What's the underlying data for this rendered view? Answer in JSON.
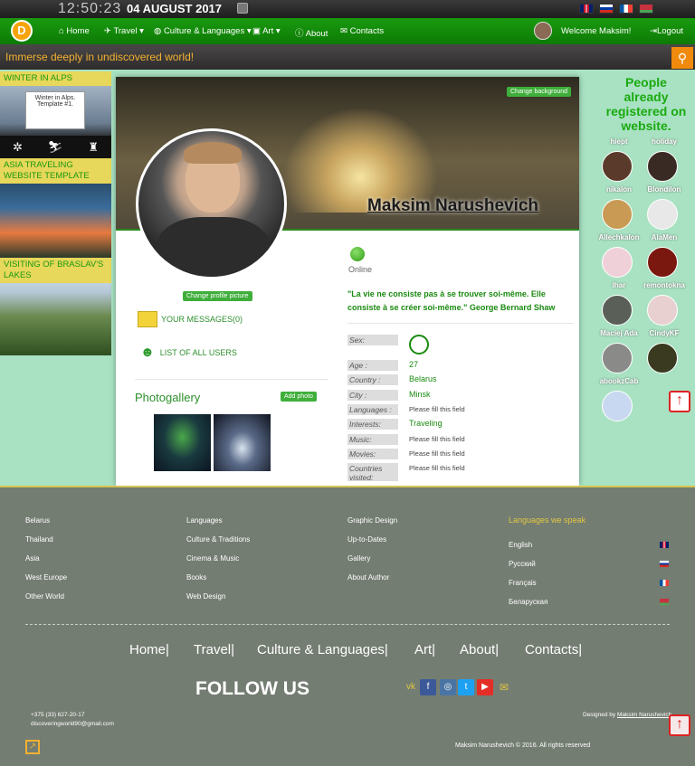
{
  "topbar": {
    "time": "12:50:23",
    "date": "04 AUGUST 2017"
  },
  "nav": {
    "logo": "D",
    "items": [
      "Home",
      "Travel ▾",
      "Culture & Languages ▾",
      "Art ▾",
      "About",
      "Contacts"
    ],
    "welcome": "Welcome Maksim!",
    "logout": "Logout"
  },
  "ticker": {
    "text": "Immerse deeply in undiscovered world!"
  },
  "sidebar": {
    "cards": [
      {
        "title": "WINTER IN ALPS",
        "caption": "Winter in Alps. Template #1."
      },
      {
        "title": "ASIA TRAVELING WEBSITE TEMPLATE"
      },
      {
        "title": "VISITING OF BRASLAV'S LAKES"
      }
    ]
  },
  "profile": {
    "name": "Maksim Narushevich",
    "change_bg": "Change background",
    "change_pic": "Change profile picture",
    "messages": "YOUR MESSAGES(0)",
    "users": "LIST OF ALL USERS",
    "gallery_title": "Photogallery",
    "add_photo": "Add photo",
    "status": "Online",
    "quote": "\"La vie ne consiste pas à se trouver soi-même. Elle consiste à se créer soi-même.\" George Bernard Shaw",
    "fields": [
      {
        "label": "Sex:",
        "value": ""
      },
      {
        "label": "Age :",
        "value": "27"
      },
      {
        "label": "Country :",
        "value": "Belarus"
      },
      {
        "label": "City :",
        "value": "Minsk"
      },
      {
        "label": "Languages :",
        "value": "Please fill this field"
      },
      {
        "label": "Interests:",
        "value": "Traveling"
      },
      {
        "label": "Music:",
        "value": "Please fill this field"
      },
      {
        "label": "Movies:",
        "value": "Please fill this field"
      },
      {
        "label": "Countries visited:",
        "value": "Please fill this field"
      }
    ]
  },
  "people": {
    "title": "People already registered on website.",
    "users": [
      {
        "name": "hiept",
        "color": "#5a3a2a"
      },
      {
        "name": "holiday",
        "color": "#3a2a24"
      },
      {
        "name": "nikalon",
        "color": "#c89a54"
      },
      {
        "name": "Blondilon",
        "color": "#e8e8e8"
      },
      {
        "name": "Allechkalon",
        "color": "#f0d0d8"
      },
      {
        "name": "AlaMen",
        "color": "#7a1810"
      },
      {
        "name": "Ihar",
        "color": "#5a6058"
      },
      {
        "name": "remontokna",
        "color": "#e8d0d0"
      },
      {
        "name": "Maciej Ada",
        "color": "#8a8a88"
      },
      {
        "name": "CindyKF",
        "color": "#3a3a20"
      },
      {
        "name": "abookzCab",
        "color": "#c8d8f0"
      }
    ]
  },
  "footer": {
    "col1": [
      "Belarus",
      "Thailand",
      "Asia",
      "West Europe",
      "Other World"
    ],
    "col2": [
      "Languages",
      "Culture & Traditions",
      "Cinema & Music",
      "Books",
      "Web Design"
    ],
    "col3": [
      "Graphic Design",
      "Up-to-Dates",
      "Gallery",
      "About Author"
    ],
    "lang_title": "Languages we speak",
    "langs": [
      "English",
      "Русский",
      "Français",
      "Беларуская"
    ],
    "nav": [
      "Home|",
      "Travel|",
      "Culture & Languages|",
      "Art|",
      "About|",
      "Contacts|"
    ],
    "follow": "FOLLOW US",
    "phone": "+375 (33) 627-20-17",
    "email": "discoveringworld90@gmail.com",
    "designed_by": "Designed by",
    "designer": "Maksim Narushevich",
    "copyright": "Maksim Narushevich © 2016. All rights reserved"
  }
}
